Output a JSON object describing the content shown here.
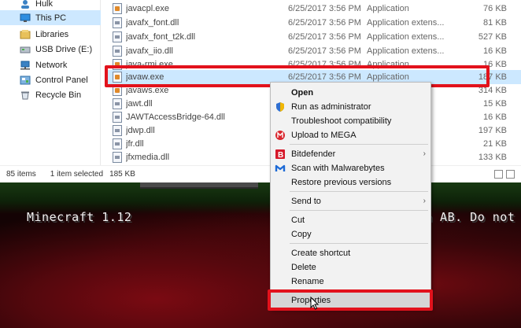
{
  "nav_pane": {
    "items": [
      {
        "label": "Hulk",
        "icon": "user-folder-icon"
      },
      {
        "label": "This PC",
        "icon": "this-pc-icon",
        "selected": true
      },
      {
        "label": "Libraries",
        "icon": "libraries-icon"
      },
      {
        "label": "USB Drive (E:)",
        "icon": "usb-drive-icon"
      },
      {
        "label": "Network",
        "icon": "network-icon"
      },
      {
        "label": "Control Panel",
        "icon": "control-panel-icon"
      },
      {
        "label": "Recycle Bin",
        "icon": "recycle-bin-icon"
      }
    ]
  },
  "files": [
    {
      "name": "javacpl.exe",
      "date": "6/25/2017 3:56 PM",
      "type": "Application",
      "size": "76 KB",
      "kind": "exe"
    },
    {
      "name": "javafx_font.dll",
      "date": "6/25/2017 3:56 PM",
      "type": "Application extens...",
      "size": "81 KB",
      "kind": "dll"
    },
    {
      "name": "javafx_font_t2k.dll",
      "date": "6/25/2017 3:56 PM",
      "type": "Application extens...",
      "size": "527 KB",
      "kind": "dll"
    },
    {
      "name": "javafx_iio.dll",
      "date": "6/25/2017 3:56 PM",
      "type": "Application extens...",
      "size": "16 KB",
      "kind": "dll"
    },
    {
      "name": "java-rmi.exe",
      "date": "6/25/2017 3:56 PM",
      "type": "Application",
      "size": "16 KB",
      "kind": "exe"
    },
    {
      "name": "javaw.exe",
      "date": "6/25/2017 3:56 PM",
      "type": "Application",
      "size": "187 KB",
      "kind": "exe",
      "selected": true
    },
    {
      "name": "javaws.exe",
      "date": "",
      "type": "",
      "size": "314 KB",
      "kind": "exe"
    },
    {
      "name": "jawt.dll",
      "date": "",
      "type": "",
      "size": "15 KB",
      "kind": "dll"
    },
    {
      "name": "JAWTAccessBridge-64.dll",
      "date": "",
      "type": "",
      "size": "16 KB",
      "kind": "dll"
    },
    {
      "name": "jdwp.dll",
      "date": "",
      "type": "",
      "size": "197 KB",
      "kind": "dll"
    },
    {
      "name": "jfr.dll",
      "date": "",
      "type": "",
      "size": "21 KB",
      "kind": "dll"
    },
    {
      "name": "jfxmedia.dll",
      "date": "",
      "type": "",
      "size": "133 KB",
      "kind": "dll"
    }
  ],
  "status_bar": {
    "item_count": "85 items",
    "selection": "1 item selected",
    "selection_size": "185 KB"
  },
  "context_menu": {
    "items": [
      {
        "label": "Open",
        "bold": true
      },
      {
        "label": "Run as administrator",
        "icon": "shield-icon"
      },
      {
        "label": "Troubleshoot compatibility"
      },
      {
        "label": "Upload to MEGA",
        "icon": "mega-icon"
      },
      {
        "separator": true
      },
      {
        "label": "Bitdefender",
        "icon": "bitdefender-icon",
        "submenu": true
      },
      {
        "label": "Scan with Malwarebytes",
        "icon": "malwarebytes-icon"
      },
      {
        "label": "Restore previous versions"
      },
      {
        "separator": true
      },
      {
        "label": "Send to",
        "submenu": true
      },
      {
        "separator": true
      },
      {
        "label": "Cut"
      },
      {
        "label": "Copy"
      },
      {
        "separator": true
      },
      {
        "label": "Create shortcut"
      },
      {
        "label": "Delete"
      },
      {
        "label": "Rename"
      },
      {
        "separator": true
      },
      {
        "label": "Properties",
        "hover": true
      }
    ]
  },
  "game": {
    "version_label": "Minecraft 1.12",
    "footer_text": "n AB. Do not di"
  },
  "colors": {
    "highlight_red": "#e2121c",
    "selection_blue": "#cce8ff"
  }
}
